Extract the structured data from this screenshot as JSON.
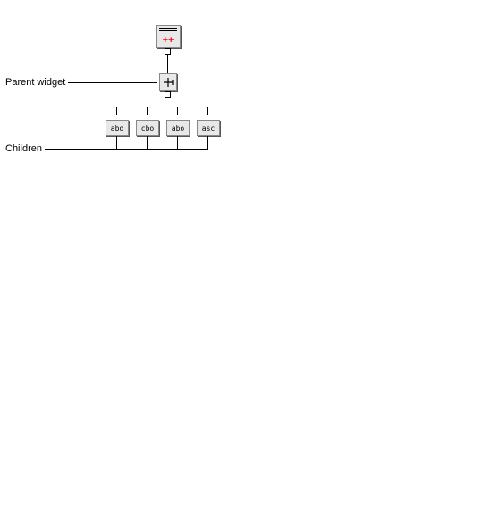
{
  "labels": {
    "parent": "Parent widget",
    "children": "Children"
  },
  "root": {
    "plus1": "+",
    "plus2": "+"
  },
  "child_labels": {
    "c1": "abo",
    "c2": "cbo",
    "c3": "abo",
    "c4": "asc"
  }
}
